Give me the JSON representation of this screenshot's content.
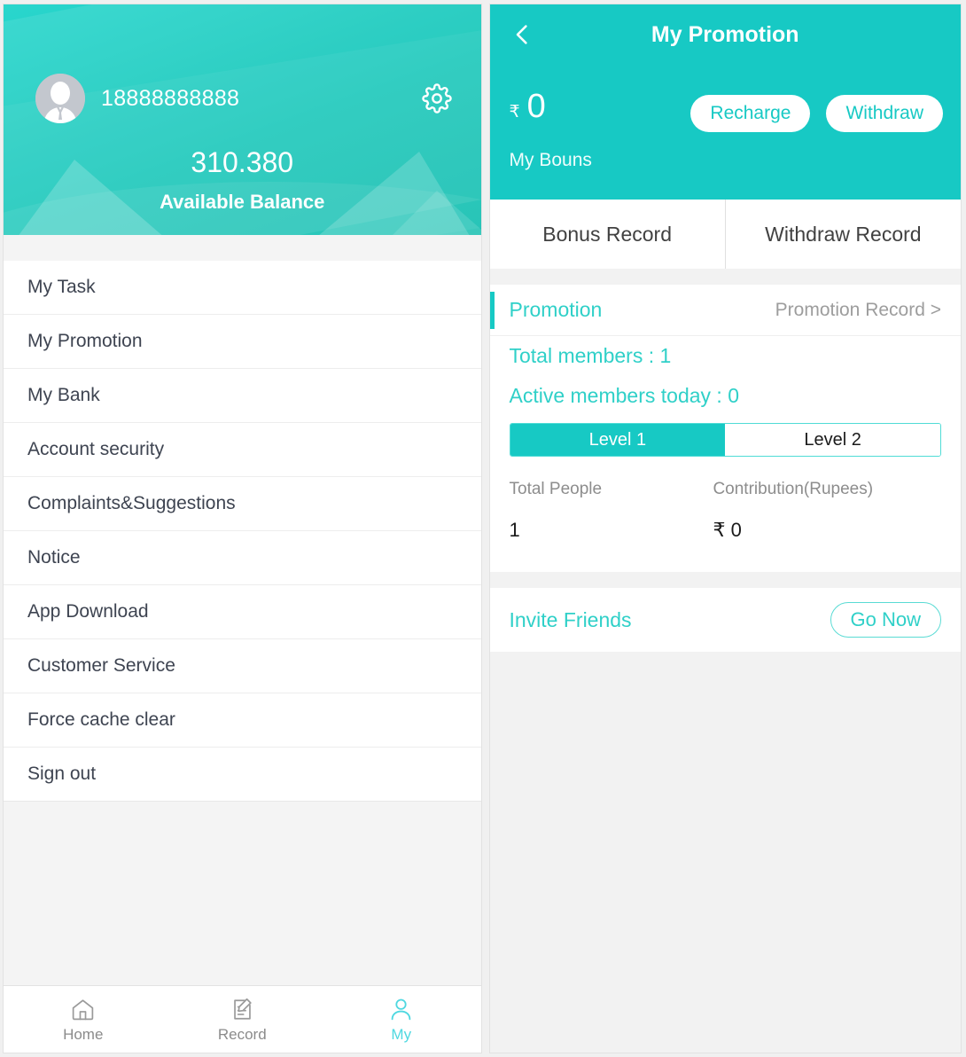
{
  "left": {
    "profile": {
      "avatar_icon": "user-avatar-icon",
      "phone_number": "18888888888",
      "settings_icon": "gear-icon",
      "balance_amount": "310.380",
      "balance_label": "Available Balance"
    },
    "menu": [
      {
        "label": "My Task",
        "name": "my-task"
      },
      {
        "label": "My Promotion",
        "name": "my-promotion"
      },
      {
        "label": "My Bank",
        "name": "my-bank"
      },
      {
        "label": "Account security",
        "name": "account-security"
      },
      {
        "label": "Complaints&Suggestions",
        "name": "complaints-suggestions"
      },
      {
        "label": "Notice",
        "name": "notice"
      },
      {
        "label": "App Download",
        "name": "app-download"
      },
      {
        "label": "Customer Service",
        "name": "customer-service"
      },
      {
        "label": "Force cache clear",
        "name": "force-cache-clear"
      },
      {
        "label": "Sign out",
        "name": "sign-out"
      }
    ],
    "tabbar": [
      {
        "label": "Home",
        "icon": "home-icon",
        "active": false
      },
      {
        "label": "Record",
        "icon": "record-document-pencil-icon",
        "active": false
      },
      {
        "label": "My",
        "icon": "person-icon",
        "active": true
      }
    ]
  },
  "right": {
    "nav": {
      "back_icon": "chevron-left-icon",
      "title": "My Promotion"
    },
    "bonus": {
      "currency_symbol": "₹",
      "value": "0",
      "label": "My Bouns",
      "recharge_label": "Recharge",
      "withdraw_label": "Withdraw"
    },
    "record_tabs": [
      {
        "label": "Bonus Record"
      },
      {
        "label": "Withdraw Record"
      }
    ],
    "promotion": {
      "title": "Promotion",
      "record_link": "Promotion Record >",
      "total_members": "Total members :  1",
      "active_members_today": "Active members today :  0",
      "levels": [
        {
          "label": "Level 1",
          "active": true
        },
        {
          "label": "Level 2",
          "active": false
        }
      ],
      "stats": {
        "people_header": "Total People",
        "people_value": "1",
        "contribution_header": "Contribution(Rupees)",
        "contribution_value": "₹ 0"
      }
    },
    "invite": {
      "label": "Invite Friends",
      "button_label": "Go Now"
    }
  },
  "colors": {
    "teal": "#17c9c4",
    "teal_light": "#2fd0c8",
    "tab_active": "#4fd8e0",
    "text_dark": "#3e4451",
    "text_muted": "#8d8d8d"
  }
}
